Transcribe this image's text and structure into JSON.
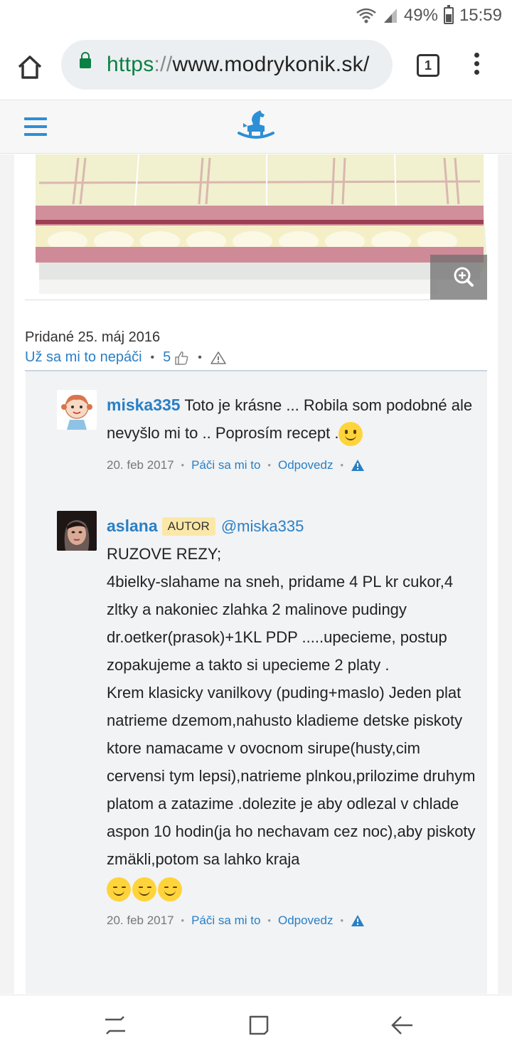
{
  "status": {
    "battery": "49%",
    "time": "15:59"
  },
  "browser": {
    "url_scheme": "https",
    "url_sep": "://",
    "url_host": "www.modrykonik.sk/",
    "tab_count": "1"
  },
  "site": {
    "brand_color": "#2d8fd5"
  },
  "post": {
    "added": "Pridané 25. máj 2016",
    "unlike_label": "Už sa mi to nepáči",
    "like_count": "5"
  },
  "comments": [
    {
      "username": "miska335",
      "text": "Toto je krásne ... Robila som podobné ale nevyšlo mi to .. Poprosím recept .",
      "date": "20. feb 2017",
      "like_label": "Páči sa mi to",
      "reply_label": "Odpovedz"
    },
    {
      "username": "aslana",
      "badge": "AUTOR",
      "mention": "@miska335",
      "lines": [
        "RUZOVE REZY;",
        "4bielky-slahame na sneh, pridame 4 PL kr cukor,4 zltky a nakoniec zlahka 2 malinove pudingy dr.oetker(prasok)+1KL PDP .....upecieme, postup zopakujeme a takto si upecieme 2 platy .",
        "Krem klasicky vanilkovy (puding+maslo) Jeden plat natrieme dzemom,nahusto kladieme detske piskoty ktore namacame v ovocnom sirupe(husty,cim cervensi tym lepsi),natrieme plnkou,prilozime druhym platom a zatazime .dolezite je aby odlezal v chlade aspon 10 hodin(ja ho nechavam cez noc),aby piskoty zmäkli,potom sa lahko kraja"
      ],
      "date": "20. feb 2017",
      "like_label": "Páči sa mi to",
      "reply_label": "Odpovedz"
    }
  ]
}
